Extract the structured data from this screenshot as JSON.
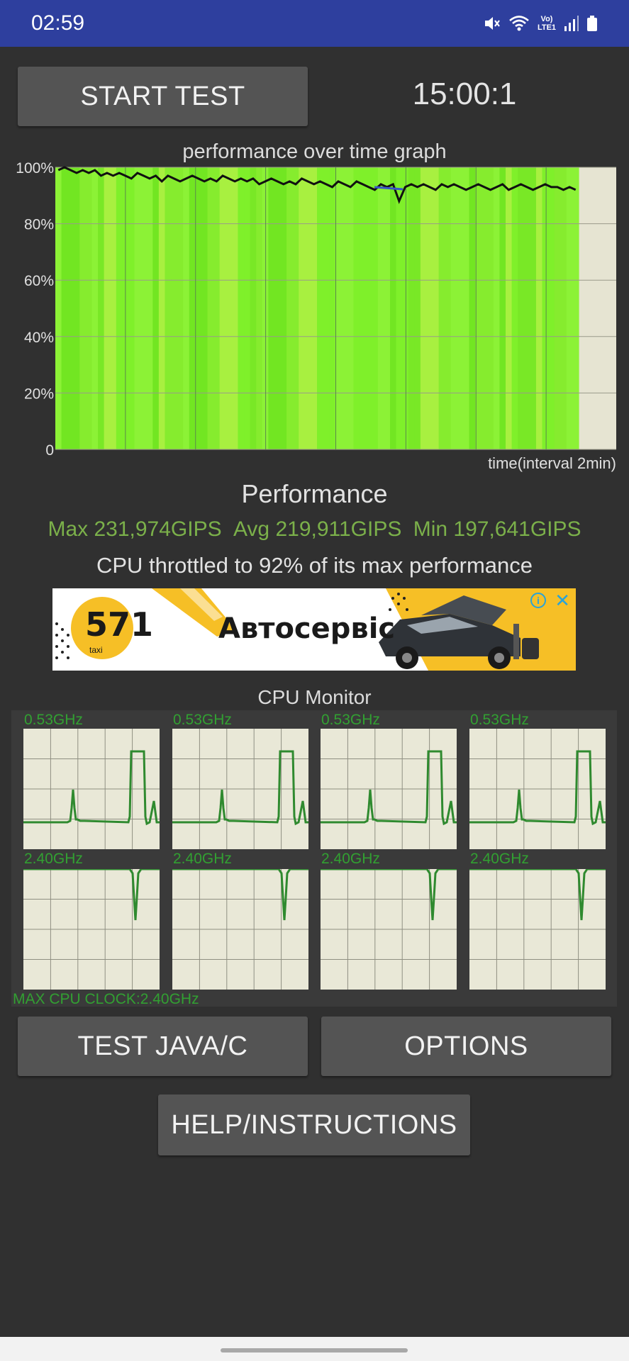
{
  "status_bar": {
    "time": "02:59",
    "network_label": "Vo) LTE1",
    "icons": [
      "mute-icon",
      "wifi-icon",
      "lte-icon",
      "signal-icon",
      "battery-icon"
    ]
  },
  "header": {
    "start_button_label": "START TEST",
    "timer": "15:00:1"
  },
  "performance_graph": {
    "title": "performance over time graph",
    "y_ticks": [
      "100%",
      "80%",
      "60%",
      "40%",
      "20%",
      "0"
    ],
    "x_label": "time(interval 2min)"
  },
  "performance": {
    "heading": "Performance",
    "max": "Max 231,974GIPS",
    "avg": "Avg 219,911GIPS",
    "min": "Min 197,641GIPS",
    "throttle_message": "CPU throttled to 92% of its max performance"
  },
  "ad": {
    "number": "571",
    "sub": "taxi",
    "text": "Автосервіс",
    "info_icon": "info-icon",
    "close_icon": "close-icon"
  },
  "cpu_monitor": {
    "title": "CPU Monitor",
    "cores": [
      {
        "freq": "0.53GHz"
      },
      {
        "freq": "0.53GHz"
      },
      {
        "freq": "0.53GHz"
      },
      {
        "freq": "0.53GHz"
      },
      {
        "freq": "2.40GHz"
      },
      {
        "freq": "2.40GHz"
      },
      {
        "freq": "2.40GHz"
      },
      {
        "freq": "2.40GHz"
      }
    ],
    "max_clock": "MAX CPU CLOCK:2.40GHz"
  },
  "buttons": {
    "test_java_c": "TEST JAVA/C",
    "options": "OPTIONS",
    "help": "HELP/INSTRUCTIONS"
  },
  "colors": {
    "status_bar": "#2e3f9e",
    "background": "#303030",
    "button": "#545454",
    "stats_green": "#7bb04a",
    "cpu_green": "#32a032",
    "graph_fill": "#7fe82c",
    "graph_bg": "#e6e4d2"
  },
  "chart_data": {
    "type": "area",
    "title": "performance over time graph",
    "xlabel": "time(interval 2min)",
    "ylabel": "",
    "ylim": [
      0,
      100
    ],
    "grid": true,
    "series": [
      {
        "values": [
          99,
          100,
          99,
          98,
          99,
          98,
          99,
          97,
          98,
          97,
          98,
          97,
          96,
          98,
          97,
          96,
          97,
          95,
          97,
          96,
          95,
          96,
          97,
          96,
          95,
          96,
          95,
          97,
          96,
          95,
          96,
          95,
          96,
          94,
          95,
          96,
          95,
          94,
          95,
          94,
          96,
          95,
          94,
          95,
          94,
          93,
          95,
          94,
          93,
          95,
          94,
          93,
          92,
          94,
          93,
          94,
          88,
          93,
          94,
          93,
          94,
          93,
          92,
          94,
          93,
          94,
          93,
          92,
          93,
          94,
          93,
          92,
          93,
          94,
          92,
          93,
          94,
          93,
          92,
          93,
          94,
          93,
          93,
          92,
          93,
          92
        ]
      }
    ]
  }
}
